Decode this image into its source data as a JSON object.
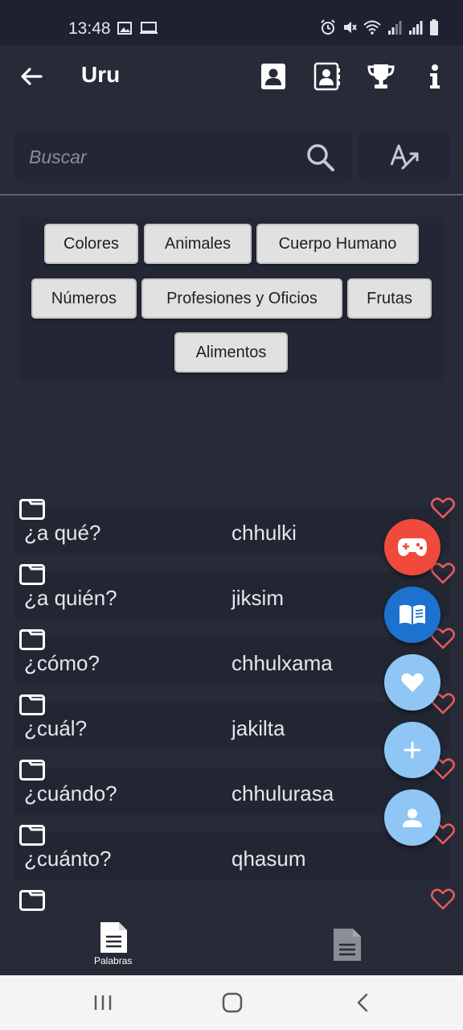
{
  "status_bar": {
    "time": "13:48",
    "left_icons": [
      "image-icon",
      "cast-icon"
    ],
    "right_icons": [
      "alarm-icon",
      "mute-icon",
      "wifi-icon",
      "signal-icon",
      "signal-icon",
      "battery-icon"
    ]
  },
  "app_bar": {
    "title": "Uru",
    "actions": [
      "contact-card-icon",
      "contact-book-icon",
      "trophy-icon",
      "info-icon"
    ]
  },
  "search": {
    "placeholder": "Buscar",
    "value": ""
  },
  "categories": [
    "Colores",
    "Animales",
    "Cuerpo Humano",
    "Números",
    "Profesiones y Oficios",
    "Frutas",
    "Alimentos"
  ],
  "words": [
    {
      "spanish": "¿a qué?",
      "translation": "chhulki"
    },
    {
      "spanish": "¿a quién?",
      "translation": "jiksim"
    },
    {
      "spanish": "¿cómo?",
      "translation": "chhulxama"
    },
    {
      "spanish": "¿cuál?",
      "translation": "jakilta"
    },
    {
      "spanish": "¿cuándo?",
      "translation": "chhulurasa"
    },
    {
      "spanish": "¿cuánto?",
      "translation": "qhasum"
    },
    {
      "spanish": "",
      "translation": ""
    }
  ],
  "fab_buttons": [
    {
      "icon": "gamepad-icon",
      "color": "#ef4a3c"
    },
    {
      "icon": "book-icon",
      "color": "#1d72cf"
    },
    {
      "icon": "heart-icon",
      "color": "#8fc6f5"
    },
    {
      "icon": "plus-icon",
      "color": "#8fc6f5"
    },
    {
      "icon": "person-icon",
      "color": "#8fc6f5"
    }
  ],
  "bottom_nav": {
    "items": [
      {
        "label": "Palabras",
        "icon": "document-icon",
        "active": true
      },
      {
        "label": "",
        "icon": "document-icon",
        "active": false
      }
    ]
  },
  "colors": {
    "background": "#272b38",
    "heart_outline": "#e85c5c",
    "chip_background": "#e1e1e1"
  }
}
